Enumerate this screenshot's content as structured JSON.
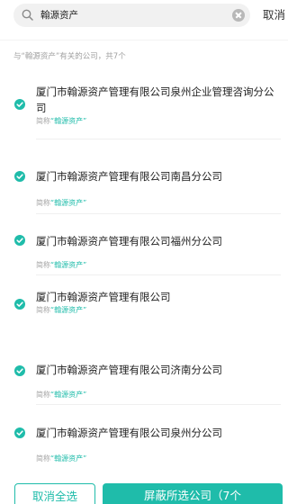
{
  "search": {
    "value": "翰源资产",
    "cancel_label": "取消"
  },
  "summary_text": "与“翰源资产”有关的公司，共7个",
  "results": [
    {
      "name": "厦门市翰源资产管理有限公司泉州企业管理咨询分公司",
      "alias_prefix": "简称",
      "alias_value": "“翰源资产”",
      "checked": true
    },
    {
      "name": "厦门市翰源资产管理有限公司南昌分公司",
      "alias_prefix": "简称",
      "alias_value": "“翰源资产”",
      "checked": true
    },
    {
      "name": "厦门市翰源资产管理有限公司福州分公司",
      "alias_prefix": "简称",
      "alias_value": "“翰源资产”",
      "checked": true
    },
    {
      "name": "厦门市翰源资产管理有限公司",
      "alias_prefix": "简称",
      "alias_value": "“翰源资产”",
      "checked": true
    },
    {
      "name": "厦门市翰源资产管理有限公司济南分公司",
      "alias_prefix": "简称",
      "alias_value": "“翰源资产”",
      "checked": true
    },
    {
      "name": "厦门市翰源资产管理有限公司泉州分公司",
      "alias_prefix": "简称",
      "alias_value": "“翰源资产”",
      "checked": true
    }
  ],
  "footer": {
    "unselect_label": "取消全选",
    "block_label": "屏蔽所选公司（7个"
  },
  "colors": {
    "accent": "#1fbcaa",
    "secondary_text": "#a6a6a6"
  },
  "icons": {
    "search": "search-icon",
    "clear": "clear-icon",
    "check": "check-circle-icon"
  }
}
